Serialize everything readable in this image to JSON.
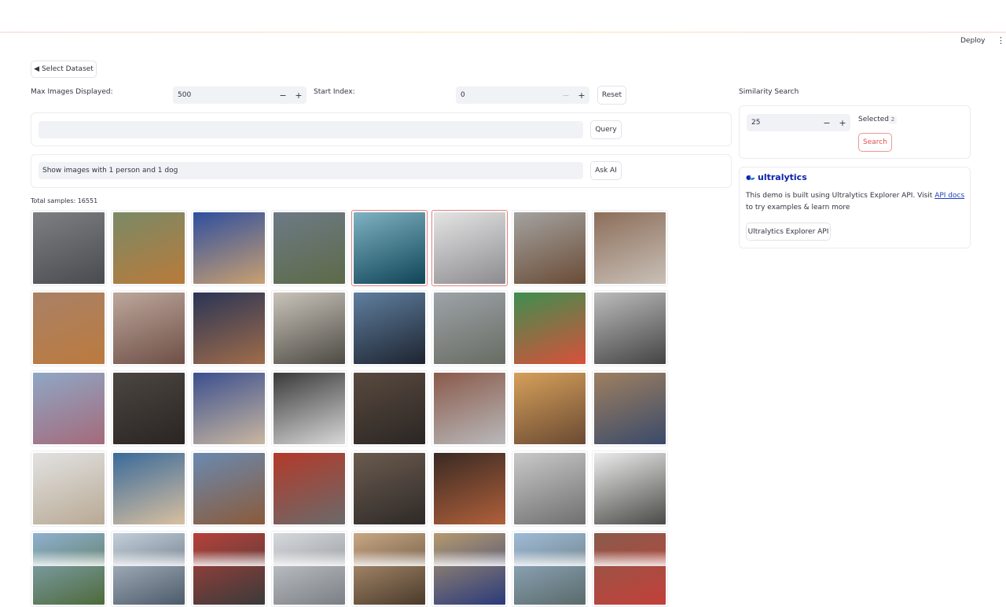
{
  "header": {
    "deploy_label": "Deploy",
    "menu_icon": "vertical-dots-icon",
    "menu_glyph": "⋮"
  },
  "select_dataset": {
    "label": "◀ Select Dataset",
    "icon": "triangle-left-icon"
  },
  "controls": {
    "max_images_label": "Max Images Displayed:",
    "max_images_value": "500",
    "start_index_label": "Start Index:",
    "start_index_value": "0",
    "minus": "−",
    "plus": "+",
    "reset_label": "Reset"
  },
  "query": {
    "value": "",
    "button": "Query"
  },
  "ask_ai": {
    "value": "Show images with 1 person and 1 dog",
    "button": "Ask AI"
  },
  "total_samples": "Total samples: 16551",
  "images": [
    {
      "name": "car-sim",
      "selected": false,
      "colors": [
        "#7e7f83",
        "#4a4b50"
      ]
    },
    {
      "name": "horse-jump",
      "selected": false,
      "colors": [
        "#7a8a66",
        "#b97a3a"
      ]
    },
    {
      "name": "cyclists",
      "selected": false,
      "colors": [
        "#2f4f9f",
        "#c9a070"
      ]
    },
    {
      "name": "car-road",
      "selected": false,
      "colors": [
        "#6d7a86",
        "#5d6a48"
      ]
    },
    {
      "name": "airplane-1",
      "selected": true,
      "colors": [
        "#7fb2c2",
        "#0f4558"
      ]
    },
    {
      "name": "airplane-2",
      "selected": true,
      "colors": [
        "#e4e4e4",
        "#8c8c90"
      ]
    },
    {
      "name": "steam-train",
      "selected": false,
      "colors": [
        "#a4a2a0",
        "#6a4c36"
      ]
    },
    {
      "name": "people-table",
      "selected": false,
      "colors": [
        "#8c6e5a",
        "#c9c0b7"
      ]
    },
    {
      "name": "dog-lying",
      "selected": false,
      "colors": [
        "#a98166",
        "#bc7a3e"
      ]
    },
    {
      "name": "train-front",
      "selected": false,
      "colors": [
        "#bda79c",
        "#6e4f46"
      ]
    },
    {
      "name": "cat-blanket",
      "selected": false,
      "colors": [
        "#2a3556",
        "#a06c4a"
      ]
    },
    {
      "name": "jeep",
      "selected": false,
      "colors": [
        "#c9c4ba",
        "#4d4a44"
      ]
    },
    {
      "name": "penguin",
      "selected": false,
      "colors": [
        "#5f7f9f",
        "#1e2430"
      ]
    },
    {
      "name": "river-boat",
      "selected": false,
      "colors": [
        "#9ea3a8",
        "#676c63"
      ]
    },
    {
      "name": "parrot",
      "selected": false,
      "colors": [
        "#3e8f4f",
        "#d8503a"
      ]
    },
    {
      "name": "walkway",
      "selected": false,
      "colors": [
        "#bcbcbc",
        "#444444"
      ]
    },
    {
      "name": "girl-flowers",
      "selected": false,
      "colors": [
        "#8fa7c6",
        "#a46a7a"
      ]
    },
    {
      "name": "cat-dark",
      "selected": false,
      "colors": [
        "#4b4642",
        "#2a2522"
      ]
    },
    {
      "name": "dogs-sleeping",
      "selected": false,
      "colors": [
        "#3b4f8f",
        "#c9b7a0"
      ]
    },
    {
      "name": "race-car",
      "selected": false,
      "colors": [
        "#3a3a3a",
        "#d8d8d8"
      ]
    },
    {
      "name": "people-room",
      "selected": false,
      "colors": [
        "#5a4a3f",
        "#2a2624"
      ]
    },
    {
      "name": "street-buildings",
      "selected": false,
      "colors": [
        "#8a5a4a",
        "#b9b9bb"
      ]
    },
    {
      "name": "two-men",
      "selected": false,
      "colors": [
        "#d6a05a",
        "#6a4a33"
      ]
    },
    {
      "name": "horse-poles",
      "selected": false,
      "colors": [
        "#9e8060",
        "#3a4a6a"
      ]
    },
    {
      "name": "cat-window",
      "selected": false,
      "colors": [
        "#e2e2e2",
        "#b8a994"
      ]
    },
    {
      "name": "cyclists-2",
      "selected": false,
      "colors": [
        "#3a6a9a",
        "#d8c0a0"
      ]
    },
    {
      "name": "cowboy-horse",
      "selected": false,
      "colors": [
        "#6a8ab0",
        "#8a5a3a"
      ]
    },
    {
      "name": "red-car-show",
      "selected": false,
      "colors": [
        "#b33a2a",
        "#6a6a6a"
      ]
    },
    {
      "name": "people-sofa",
      "selected": false,
      "colors": [
        "#6b5b4f",
        "#2e2a28"
      ]
    },
    {
      "name": "dog-fire",
      "selected": false,
      "colors": [
        "#3a2a24",
        "#b0603a"
      ]
    },
    {
      "name": "white-bird",
      "selected": false,
      "colors": [
        "#c9c9c9",
        "#6f6f6f"
      ]
    },
    {
      "name": "pier-grey",
      "selected": false,
      "colors": [
        "#ececec",
        "#4a4a48"
      ]
    },
    {
      "name": "landscape-1",
      "selected": false,
      "colors": [
        "#8fb1d0",
        "#4d6a3a"
      ]
    },
    {
      "name": "mountains",
      "selected": false,
      "colors": [
        "#c3cfd9",
        "#4d5a6a"
      ]
    },
    {
      "name": "red-car",
      "selected": false,
      "colors": [
        "#b5413a",
        "#3a3a3a"
      ]
    },
    {
      "name": "white-van",
      "selected": false,
      "colors": [
        "#d6d9dc",
        "#7a7f85"
      ]
    },
    {
      "name": "room-person",
      "selected": false,
      "colors": [
        "#c8a784",
        "#4a3a2a"
      ]
    },
    {
      "name": "bike-rider",
      "selected": false,
      "colors": [
        "#b59a6f",
        "#2a3a7a"
      ]
    },
    {
      "name": "snow-mountain",
      "selected": false,
      "colors": [
        "#9fbbd6",
        "#5a6a6a"
      ]
    },
    {
      "name": "person-red",
      "selected": false,
      "colors": [
        "#8a5a4a",
        "#c2403a"
      ]
    }
  ],
  "similarity": {
    "title": "Similarity Search",
    "value": "25",
    "selected_label": "Selected:",
    "selected_count": "2",
    "search_button": "Search"
  },
  "ultralytics": {
    "brand": "ultralytics",
    "logo_icon": "ultralytics-logo-icon",
    "desc_pre": "This demo is built using Ultralytics Explorer API. Visit ",
    "link": "API docs",
    "desc_post": " to try examples & learn more",
    "button": "Ultralytics Explorer API"
  }
}
